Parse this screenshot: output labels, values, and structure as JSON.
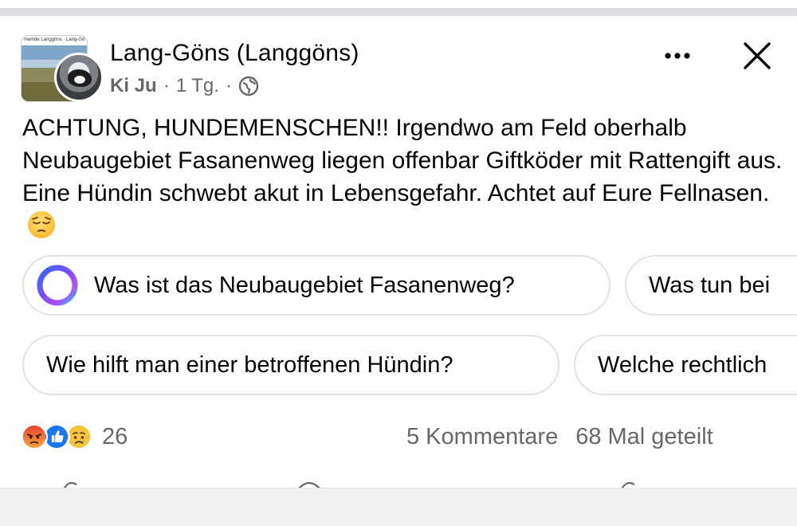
{
  "post": {
    "page_name": "Lang-Göns (Langgöns)",
    "avatar_caption": "meinde Langgöns · Lang-Gö",
    "author": "Ki Ju",
    "time": "1 Tg.",
    "separator": "·",
    "visibility_icon": "globe-icon",
    "text": "ACHTUNG, HUNDEMENSCHEN!! Irgendwo am Feld oberhalb Neubaugebiet Fasanenweg liegen offenbar Giftköder mit Rattengift aus. Eine Hündin schwebt akut in Lebensgefahr. Achtet auf Eure Fellnasen.",
    "text_emoji": "pensive-face-emoji"
  },
  "header": {
    "more_icon": "more-dots-icon",
    "close_icon": "close-icon"
  },
  "suggestions": [
    {
      "label": "Was ist das Neubaugebiet Fasanenweg?",
      "icon": "meta-ai-ring-icon"
    },
    {
      "label": "Was tun bei"
    },
    {
      "label": "Wie hilft man einer betroffenen Hündin?"
    },
    {
      "label": "Welche rechtlich"
    }
  ],
  "engagement": {
    "reaction_icons": [
      "angry-reaction-icon",
      "like-reaction-icon",
      "sad-reaction-icon"
    ],
    "reaction_count": "26",
    "comments": "5 Kommentare",
    "shares": "68 Mal geteilt"
  },
  "colors": {
    "text": "#050505",
    "secondary": "#65676b",
    "chip_border": "#e1e3e6",
    "like_blue": "#1877f2"
  }
}
